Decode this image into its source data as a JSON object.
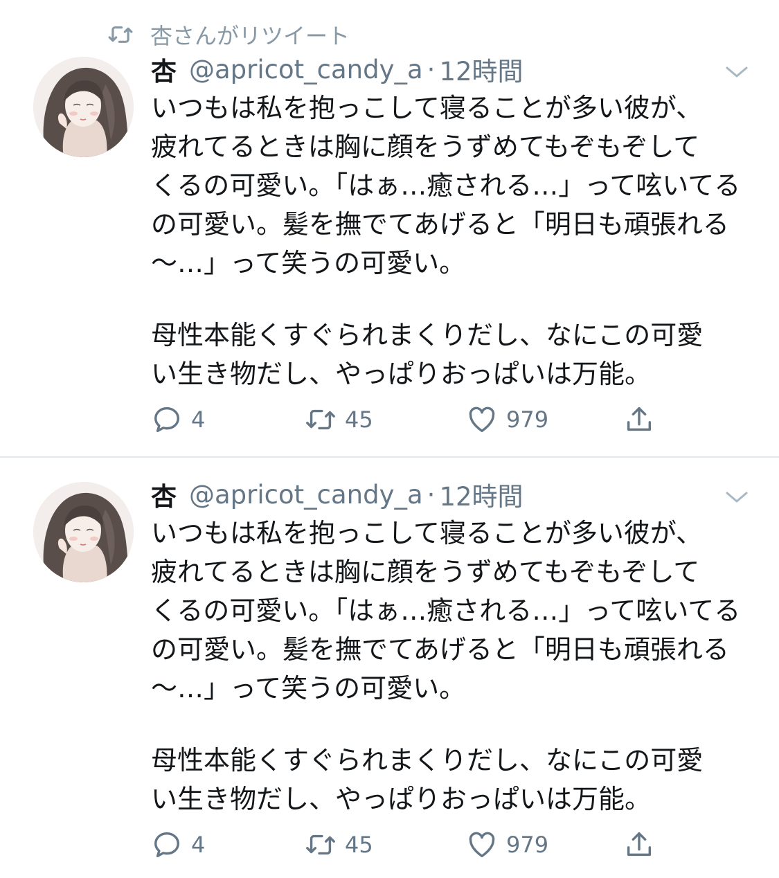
{
  "retweet_context": {
    "label": "杏さんがリツイート",
    "icon": "retweet-icon",
    "color": "#8899a6"
  },
  "tweets": [
    {
      "name": "杏",
      "handle": "@apricot_candy_a",
      "separator": "·",
      "time": "12時間",
      "lines": [
        "いつもは私を抱っこして寝ることが多い彼が、",
        "疲れてるときは胸に顔をうずめてもぞもぞして",
        "くるの可愛い。「はぁ…癒される…」って呟いてる",
        "の可愛い。髪を撫でてあげると「明日も頑張れる",
        "〜…」って笑うの可愛い。",
        "",
        "母性本能くすぐられまくりだし、なにこの可愛",
        "い生き物だし、やっぱりおっぱいは万能。"
      ],
      "replies": "4",
      "retweets": "45",
      "likes": "979"
    },
    {
      "name": "杏",
      "handle": "@apricot_candy_a",
      "separator": "·",
      "time": "12時間",
      "lines": [
        "いつもは私を抱っこして寝ることが多い彼が、",
        "疲れてるときは胸に顔をうずめてもぞもぞして",
        "くるの可愛い。「はぁ…癒される…」って呟いてる",
        "の可愛い。髪を撫でてあげると「明日も頑張れる",
        "〜…」って笑うの可愛い。",
        "",
        "母性本能くすぐられまくりだし、なにこの可愛",
        "い生き物だし、やっぱりおっぱいは万能。"
      ],
      "replies": "4",
      "retweets": "45",
      "likes": "979"
    }
  ],
  "colors": {
    "text": "#14171a",
    "secondary": "#657786",
    "divider": "#e1e8ed",
    "background": "#ffffff"
  },
  "icons": [
    "retweet-icon",
    "chevron-down-icon",
    "reply-icon",
    "like-icon",
    "share-icon"
  ]
}
